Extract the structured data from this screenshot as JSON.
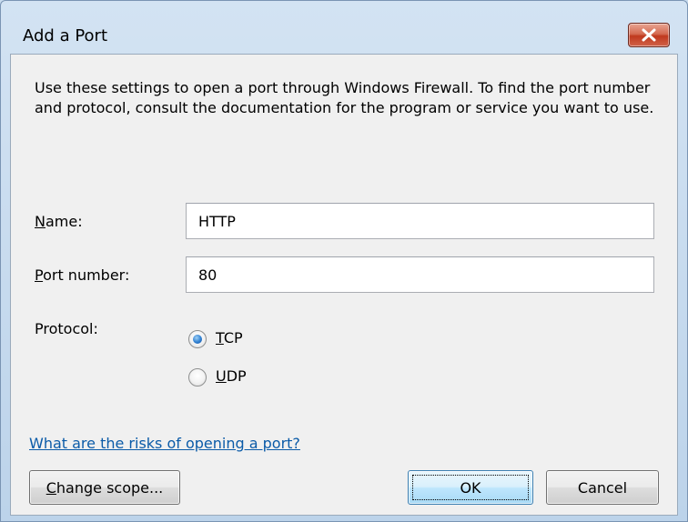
{
  "window": {
    "title": "Add a Port"
  },
  "description": "Use these settings to open a port through Windows Firewall. To find the port number and protocol, consult the documentation for the program or service you want to use.",
  "form": {
    "name_label_mnemonic": "N",
    "name_label_rest": "ame:",
    "name_value": "HTTP",
    "port_label_mnemonic": "P",
    "port_label_rest": "ort number:",
    "port_value": "80",
    "protocol_label": "Protocol:",
    "protocols": [
      {
        "mnemonic": "T",
        "rest": "CP",
        "selected": true
      },
      {
        "mnemonic": "U",
        "rest": "DP",
        "selected": false
      }
    ]
  },
  "risks_link": "What are the risks of opening a port?",
  "buttons": {
    "change_scope_mnemonic": "C",
    "change_scope_rest": "hange scope...",
    "ok": "OK",
    "cancel": "Cancel"
  },
  "colors": {
    "link": "#0b5ba8",
    "close_button": "#c0391e",
    "client_background": "#f0f0f0"
  },
  "icons": {
    "close": "close-icon"
  }
}
